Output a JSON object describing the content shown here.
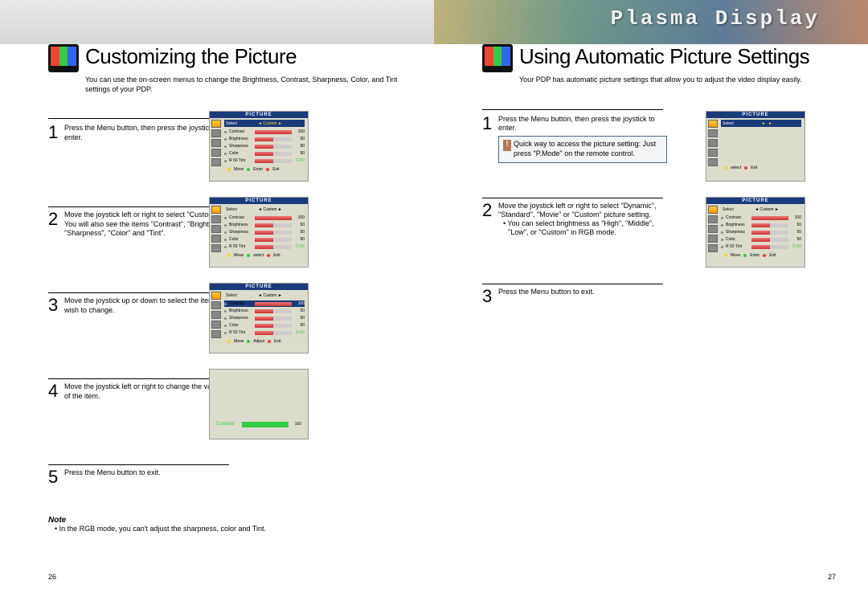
{
  "brand": "Plasma Display",
  "left": {
    "title": "Customizing the Picture",
    "desc": "You can use the on-screen menus to change the Brightness, Contrast, Sharpness, Color, and Tint settings of your PDP.",
    "steps": [
      {
        "num": "1",
        "text": "Press the Menu button, then press the joystick to enter."
      },
      {
        "num": "2",
        "text": "Move the joystick left or right to select \"Custom\". You will also see the items \"Contrast\", \"Brightness\", \"Sharpness\", \"Color\" and \"Tint\"."
      },
      {
        "num": "3",
        "text": "Move the joystick up or down to select the item you wish to change."
      },
      {
        "num": "4",
        "text": "Move the joystick left or right to change the value of the item."
      },
      {
        "num": "5",
        "text": "Press the Menu button to exit."
      }
    ],
    "note_label": "Note",
    "note_text": "• In the RGB mode, you can't adjust the sharpness, color and Tint.",
    "page": "26"
  },
  "right": {
    "title": "Using Automatic Picture Settings",
    "desc": "Your PDP has automatic picture settings that allow you to adjust the video display easily.",
    "steps": [
      {
        "num": "1",
        "text": "Press the Menu button, then press the joystick to enter.",
        "tip": "Quick way to access the picture setting: Just press \"P.Mode\" on the remote control."
      },
      {
        "num": "2",
        "text": "Move the joystick left or right to select \"Dynamic\", \"Standard\", \"Movie\" or \"Custom\" picture setting.",
        "bullet": "• You can select brightness as \"High\", \"Middle\", \"Low\", or \"Custom\" in RGB mode."
      },
      {
        "num": "3",
        "text": "Press the Menu button to exit."
      }
    ],
    "page": "27"
  },
  "osd": {
    "header": "PICTURE",
    "select": "Select",
    "custom": "Custom",
    "rows": [
      {
        "label": "Contrast",
        "val": "100",
        "pct": 100
      },
      {
        "label": "Brightness",
        "val": "50",
        "pct": 50
      },
      {
        "label": "Sharpness",
        "val": "50",
        "pct": 50
      },
      {
        "label": "Color",
        "val": "50",
        "pct": 50
      },
      {
        "label": "Tint",
        "val": "G 50",
        "pct": 50,
        "prefix": "R 50"
      }
    ],
    "foot_move": "Move",
    "foot_enter": "Enter",
    "foot_select": "select",
    "foot_adjust": "Adjust",
    "foot_exit": "Exit"
  }
}
